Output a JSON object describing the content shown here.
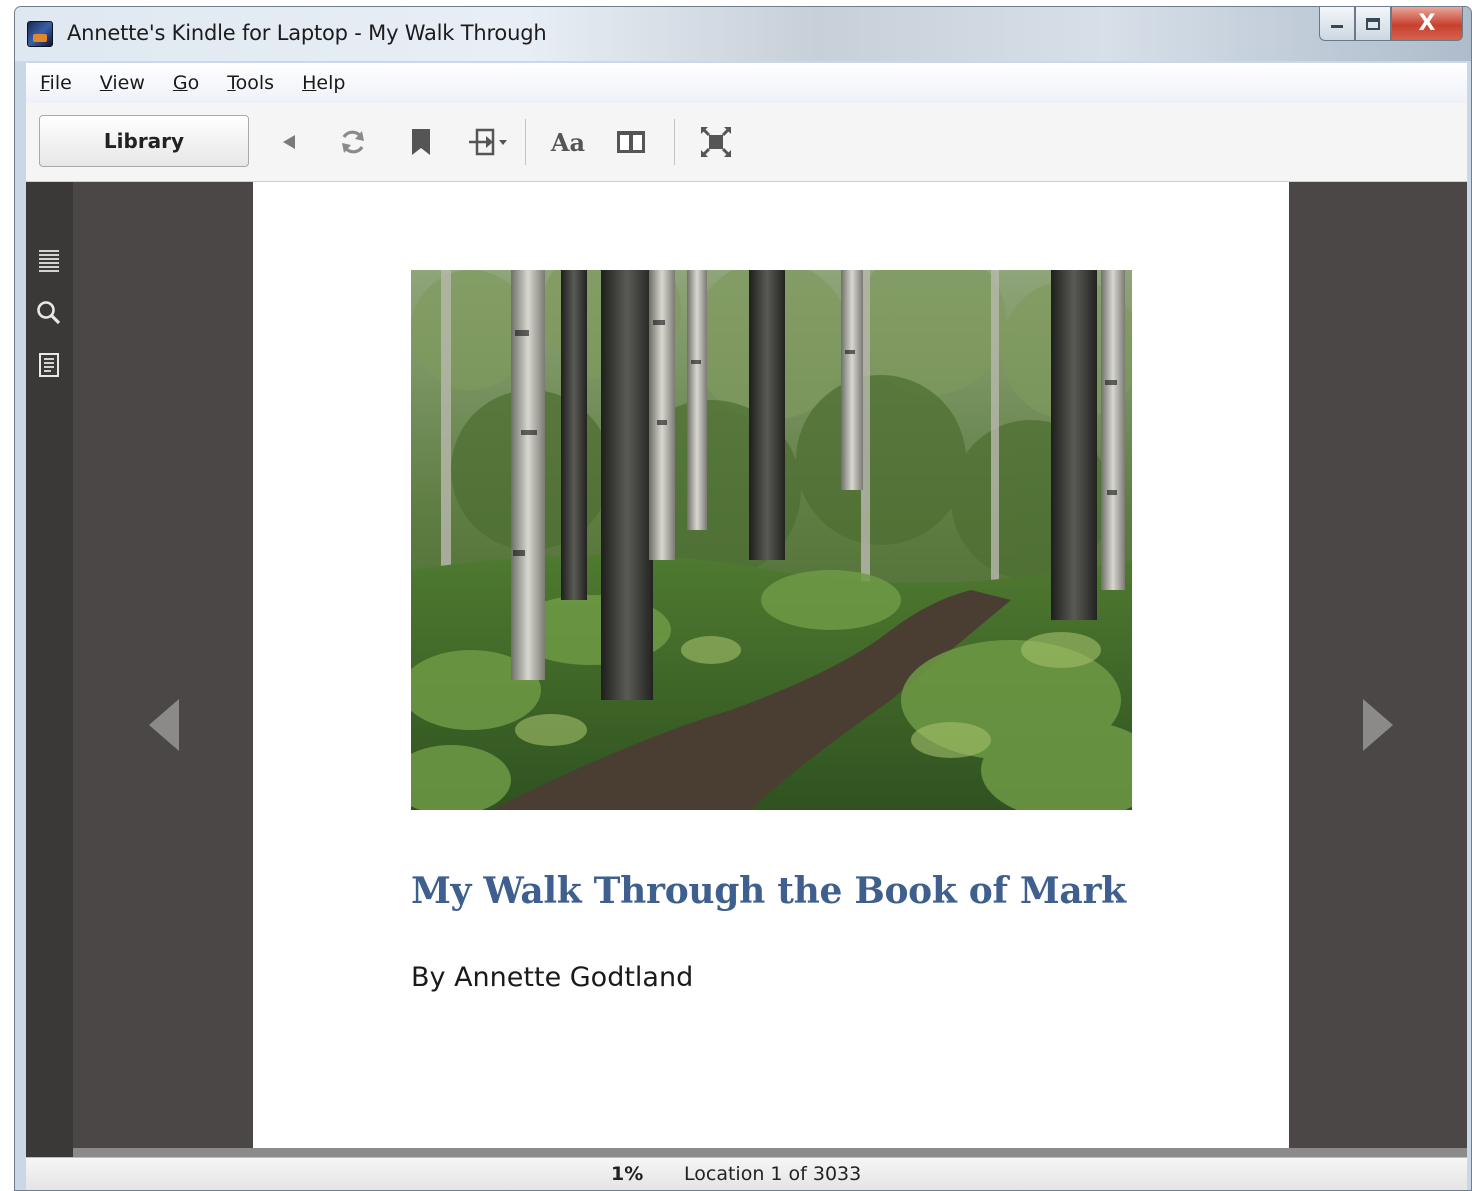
{
  "window": {
    "title": "Annette's Kindle for Laptop - My Walk Through",
    "close_glyph": "X"
  },
  "menu": [
    {
      "key": "F",
      "rest": "ile"
    },
    {
      "key": "V",
      "rest": "iew"
    },
    {
      "key": "G",
      "rest": "o"
    },
    {
      "key": "T",
      "rest": "ools"
    },
    {
      "key": "H",
      "rest": "elp"
    }
  ],
  "toolbar": {
    "library_label": "Library",
    "font_label": "Aa",
    "icons": [
      "back-icon",
      "sync-icon",
      "bookmark-icon",
      "goto-icon",
      "font-settings-icon",
      "columns-icon",
      "fullscreen-icon"
    ]
  },
  "sidebar": {
    "icons": [
      "toc-icon",
      "search-icon",
      "notes-icon"
    ]
  },
  "book": {
    "title": "My Walk Through the Book of Mark",
    "author": "By Annette Godtland",
    "cover_image": "forest-path-birch-trees"
  },
  "status": {
    "percent": "1%",
    "location": "Location 1 of 3033"
  },
  "colors": {
    "title_blue": "#3f5f8e",
    "reader_bg": "#4a4746",
    "rail_bg": "#3b3938"
  }
}
